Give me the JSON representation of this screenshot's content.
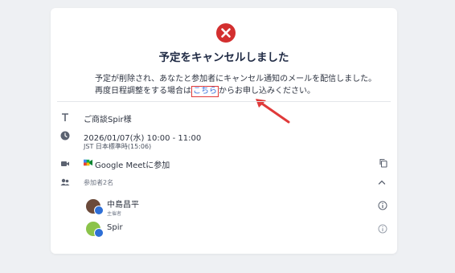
{
  "status": {
    "icon": "error-circle-icon",
    "color": "#d32f2f",
    "title": "予定をキャンセルしました",
    "message_line1": "予定が削除され、あなたと参加者にキャンセル通知のメールを配信しました。",
    "message_line2_before": "再度日程調整をする場合は",
    "message_link": "こちら",
    "message_line2_after": "からお申し込みください。"
  },
  "event": {
    "title": "ご商談Spir様",
    "datetime": "2026/01/07(水) 10:00 - 11:00",
    "timezone": "JST 日本標準時(15:06)",
    "meet_label": "Google Meetに参加"
  },
  "attendees": {
    "header": "参加者2名",
    "list": [
      {
        "name": "中島昌平",
        "role": "主催者"
      },
      {
        "name": "Spir",
        "role": ""
      }
    ]
  },
  "colors": {
    "accent": "#2e6fd6",
    "annotation": "#e03a3a"
  }
}
